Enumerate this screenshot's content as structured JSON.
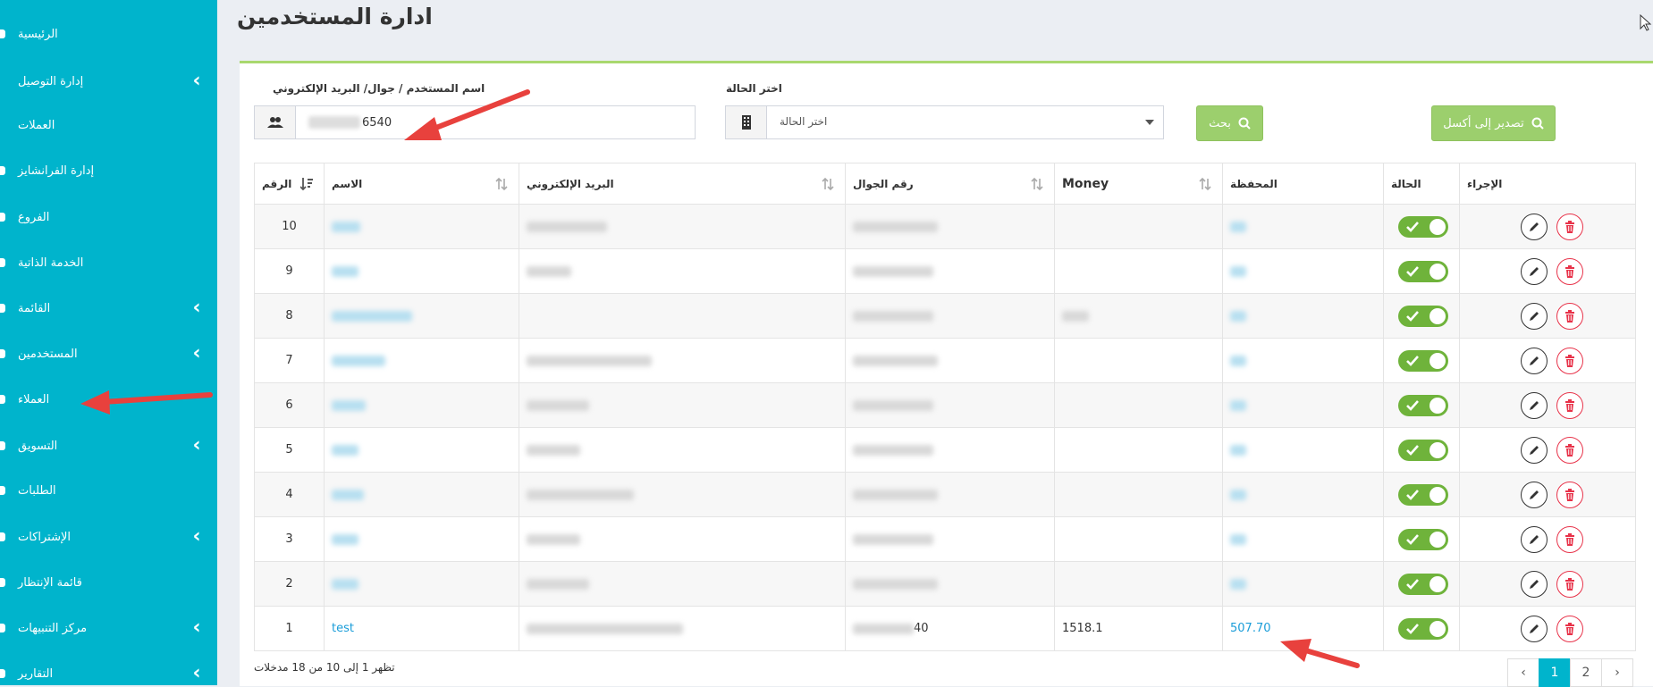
{
  "page": {
    "title": "ادارة المستخدمين"
  },
  "sidebar": {
    "items": [
      {
        "label": "الرئيسية",
        "has_submenu": false
      },
      {
        "label": "إدارة التوصيل",
        "has_submenu": true
      },
      {
        "label": "العملات",
        "has_submenu": false
      },
      {
        "label": "إدارة الفرانشايز",
        "has_submenu": false
      },
      {
        "label": "الفروع",
        "has_submenu": false
      },
      {
        "label": "الخدمة الذاتية",
        "has_submenu": false
      },
      {
        "label": "القائمة",
        "has_submenu": true
      },
      {
        "label": "المستخدمين",
        "has_submenu": true
      },
      {
        "label": "العملاء",
        "has_submenu": false
      },
      {
        "label": "التسويق",
        "has_submenu": true
      },
      {
        "label": "الطلبات",
        "has_submenu": false
      },
      {
        "label": "الإشتراكات",
        "has_submenu": true
      },
      {
        "label": "قائمة الإنتظار",
        "has_submenu": false
      },
      {
        "label": "مركز التنبيهات",
        "has_submenu": true
      },
      {
        "label": "التقارير",
        "has_submenu": true
      }
    ]
  },
  "filters": {
    "search_label": "اسم المستخدم / جوال/ البريد الإلكتروني",
    "search_value_visible": "6540",
    "status_label": "اختر الحالة",
    "status_value": "اختر الحالة",
    "search_button": "بحث",
    "export_button": "تصدير إلى أكسل"
  },
  "table": {
    "headers": {
      "number": "الرقم",
      "name": "الاسم",
      "email": "البريد الإلكتروني",
      "phone": "رقم الجوال",
      "money": "Money",
      "wallet": "المحفظة",
      "status": "الحالة",
      "actions": "الإجراء"
    },
    "rows": [
      {
        "number": "10",
        "name": "",
        "email": "",
        "phone": "",
        "money": "",
        "wallet": ""
      },
      {
        "number": "9",
        "name": "",
        "email": "",
        "phone": "",
        "money": "",
        "wallet": ""
      },
      {
        "number": "8",
        "name": "",
        "email": "",
        "phone": "",
        "money": "",
        "wallet": ""
      },
      {
        "number": "7",
        "name": "",
        "email": "",
        "phone": "",
        "money": "",
        "wallet": ""
      },
      {
        "number": "6",
        "name": "",
        "email": "",
        "phone": "",
        "money": "",
        "wallet": ""
      },
      {
        "number": "5",
        "name": "",
        "email": "",
        "phone": "",
        "money": "",
        "wallet": ""
      },
      {
        "number": "4",
        "name": "",
        "email": "",
        "phone": "",
        "money": "",
        "wallet": ""
      },
      {
        "number": "3",
        "name": "",
        "email": "",
        "phone": "",
        "money": "",
        "wallet": ""
      },
      {
        "number": "2",
        "name": "",
        "email": "",
        "phone": "",
        "money": "",
        "wallet": ""
      },
      {
        "number": "1",
        "name": "test",
        "email": "",
        "phone": "40",
        "money": "1518.1",
        "wallet": "507.70"
      }
    ]
  },
  "footer": {
    "info": "تظهر 1 إلى 10 من 18 مدخلات",
    "pages": [
      "‹",
      "1",
      "2",
      "›"
    ],
    "active_page": "1"
  },
  "colors": {
    "sidebar": "#00b4cc",
    "button": "#9ccf6d",
    "toggle": "#6fb33b",
    "delete": "#e8334a",
    "link": "#1a9dd9",
    "annotation": "#e8413d"
  }
}
